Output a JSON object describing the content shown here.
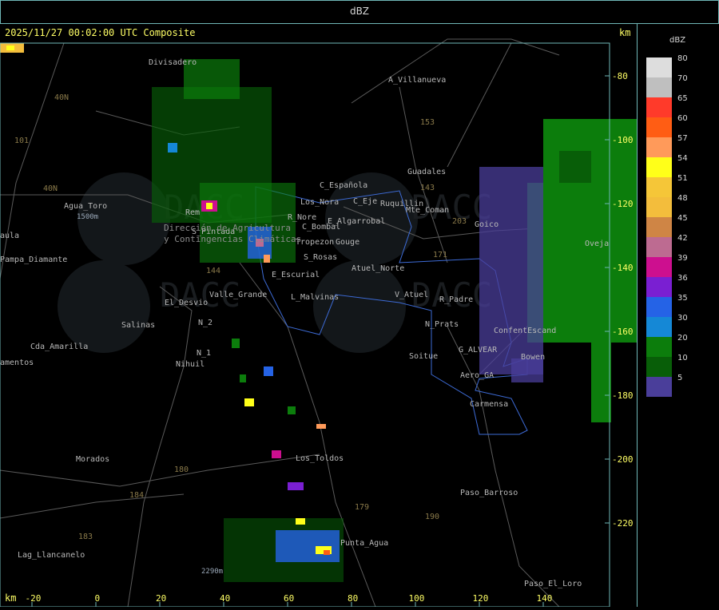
{
  "title": "dBZ",
  "timestamp": "2025/11/27 00:02:00 UTC Composite",
  "unit_top": "km",
  "unit_bottom": "km",
  "legend": {
    "title": "dBZ",
    "levels": [
      {
        "label": "80",
        "color": "#dddddd"
      },
      {
        "label": "70",
        "color": "#bfbfbf"
      },
      {
        "label": "65",
        "color": "#ff3a2a"
      },
      {
        "label": "60",
        "color": "#ff5d14"
      },
      {
        "label": "57",
        "color": "#ff9a5a"
      },
      {
        "label": "54",
        "color": "#ffff19"
      },
      {
        "label": "51",
        "color": "#f5c638"
      },
      {
        "label": "48",
        "color": "#f3bd3c"
      },
      {
        "label": "45",
        "color": "#cf8545"
      },
      {
        "label": "42",
        "color": "#bd6b91"
      },
      {
        "label": "39",
        "color": "#cd0f8f"
      },
      {
        "label": "36",
        "color": "#7a1fd2"
      },
      {
        "label": "35",
        "color": "#2563e6"
      },
      {
        "label": "30",
        "color": "#1588d6"
      },
      {
        "label": "20",
        "color": "#0c7d0c"
      },
      {
        "label": "10",
        "color": "#085e08"
      },
      {
        "label": "5",
        "color": "#4a3e9a"
      }
    ]
  },
  "axes": {
    "x_ticks": [
      "-20",
      "0",
      "20",
      "40",
      "60",
      "80",
      "100",
      "120",
      "140"
    ],
    "y_ticks": [
      "-80",
      "-100",
      "-120",
      "-140",
      "-160",
      "-180",
      "-200",
      "-220"
    ]
  },
  "places": [
    "Divisadero",
    "A_Villanueva",
    "C_Española",
    "Guadales",
    "Los_Nora",
    "C_Eje",
    "Ruquillin",
    "Mte_Coman",
    "R_Nore",
    "E_Algarrobal",
    "Goico",
    "Agua_Toro",
    "Rem",
    "S_Pintada",
    "C_Bombal",
    "Tropezon",
    "Gouge",
    "aula",
    "S_Rosas",
    "Pampa_Diamante",
    "Atuel_Norte",
    "E_Escurial",
    "V_Atuel",
    "R_Padre",
    "Valle_Grande",
    "L_Malvinas",
    "El_Desvio",
    "N_2",
    "Salinas",
    "N_Prats",
    "ConfentEscand",
    "Cda_Amarilla",
    "N_1",
    "Soitue",
    "G_ALVEAR",
    "Bowen",
    "amentos",
    "Nihuil",
    "Aero_GA",
    "Carmensa",
    "Los_Toldos",
    "Morados",
    "Paso_Barroso",
    "Punta_Agua",
    "Lag_Llancanelo",
    "Paso_El_Loro",
    "Oveja",
    "Dirección de Agricultura",
    "y Contingencias Climáticas"
  ],
  "route_labels": [
    "40N",
    "101",
    "153",
    "143",
    "203",
    "171",
    "144",
    "180",
    "184",
    "179",
    "190",
    "183",
    "40N"
  ],
  "elevation_labels": [
    "1500m",
    "2290m"
  ],
  "watermark": "DACC"
}
